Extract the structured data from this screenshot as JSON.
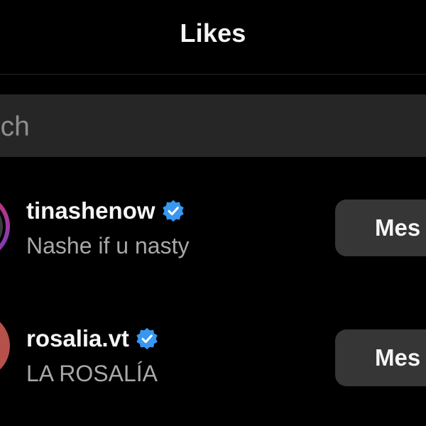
{
  "header": {
    "title": "Likes"
  },
  "search": {
    "text": "arch"
  },
  "likes": [
    {
      "username": "tinashenow",
      "full_name": "Nashe if u nasty",
      "verified": true,
      "has_story_ring": true,
      "button_label": "Mes"
    },
    {
      "username": "rosalia.vt",
      "full_name": "LA ROSALÍA",
      "verified": true,
      "has_story_ring": false,
      "button_label": "Mes"
    }
  ],
  "colors": {
    "background": "#000000",
    "search_bg": "#262626",
    "button_bg": "#363636",
    "verified_blue": "#3897f0",
    "secondary_text": "#a8a8a8"
  },
  "icons": {
    "verified": "verified-badge-icon"
  }
}
